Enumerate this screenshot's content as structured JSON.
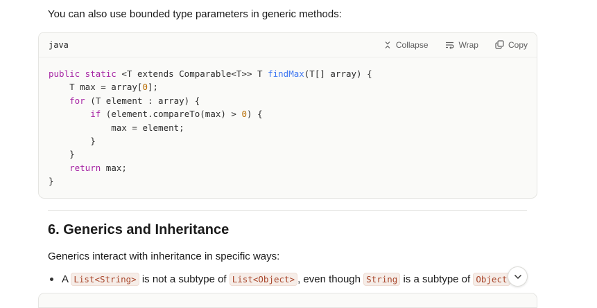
{
  "intro_text": "You can also use bounded type parameters in generic methods:",
  "code_block": {
    "language": "java",
    "actions": {
      "collapse_label": "Collapse",
      "wrap_label": "Wrap",
      "copy_label": "Copy"
    },
    "lines": [
      [
        {
          "t": "public static",
          "c": "kw"
        },
        {
          "t": " <T extends Comparable<T>> T "
        },
        {
          "t": "findMax",
          "c": "fn"
        },
        {
          "t": "(T[] array) {"
        }
      ],
      [
        {
          "t": "    T max = array["
        },
        {
          "t": "0",
          "c": "num"
        },
        {
          "t": "];"
        }
      ],
      [
        {
          "t": "    "
        },
        {
          "t": "for",
          "c": "kw"
        },
        {
          "t": " (T element : array) {"
        }
      ],
      [
        {
          "t": "        "
        },
        {
          "t": "if",
          "c": "kw"
        },
        {
          "t": " (element.compareTo(max) > "
        },
        {
          "t": "0",
          "c": "num"
        },
        {
          "t": ") {"
        }
      ],
      [
        {
          "t": "            max = element;"
        }
      ],
      [
        {
          "t": "        }"
        }
      ],
      [
        {
          "t": "    }"
        }
      ],
      [
        {
          "t": "    "
        },
        {
          "t": "return",
          "c": "kw"
        },
        {
          "t": " max;"
        }
      ],
      [
        {
          "t": "}"
        }
      ]
    ]
  },
  "section": {
    "heading": "6. Generics and Inheritance",
    "paragraph": "Generics interact with inheritance in specific ways:",
    "bullet": {
      "p1": "A ",
      "code1": "List<String>",
      "p2": " is not a subtype of ",
      "code2": "List<Object>",
      "p3": ", even though ",
      "code3": "String",
      "p4": " is a subtype of ",
      "code4": "Object",
      "p5": "."
    }
  },
  "icons": {
    "collapse": "collapse-icon",
    "wrap": "wrap-icon",
    "copy": "copy-icon",
    "scroll": "chevron-down-icon"
  }
}
